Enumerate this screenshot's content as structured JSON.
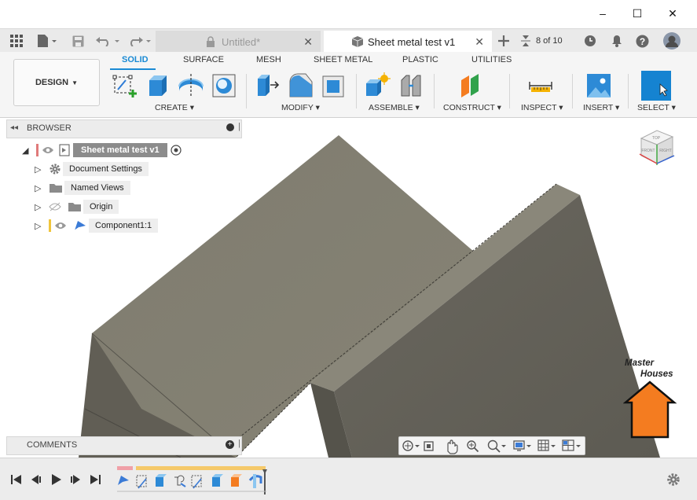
{
  "window": {
    "minimize_glyph": "–",
    "maximize_glyph": "☐",
    "close_glyph": "✕"
  },
  "tabs": [
    {
      "title": "Untitled*",
      "locked": true,
      "active": false
    },
    {
      "title": "Sheet metal test v1",
      "active": true
    }
  ],
  "tab_strip": {
    "job_status": "8 of 10"
  },
  "toolbar": {
    "workspace_button": "DESIGN",
    "workspace_tabs": [
      "SOLID",
      "SURFACE",
      "MESH",
      "SHEET METAL",
      "PLASTIC",
      "UTILITIES"
    ],
    "active_workspace_tab": "SOLID",
    "groups": [
      "CREATE",
      "MODIFY",
      "ASSEMBLE",
      "CONSTRUCT",
      "INSPECT",
      "INSERT",
      "SELECT"
    ]
  },
  "browser": {
    "title": "BROWSER",
    "root": "Sheet metal test v1",
    "items": [
      {
        "label": "Document Settings",
        "icon": "gear-icon"
      },
      {
        "label": "Named Views",
        "icon": "folder-icon"
      },
      {
        "label": "Origin",
        "icon": "folder-icon",
        "visibility": "hidden"
      },
      {
        "label": "Component1:1",
        "icon": "component-icon",
        "visibility": "visible"
      }
    ]
  },
  "comments": {
    "title": "COMMENTS"
  },
  "viewcube": {
    "faces": [
      "TOP",
      "FRONT",
      "RIGHT"
    ]
  },
  "watermark": {
    "line1": "Master",
    "line2": "Houses"
  },
  "colors": {
    "accent": "#1a8ad4",
    "part_top": "#807d70",
    "part_side": "#5b5950",
    "flange_face": "#67645b",
    "watermark_house": "#f47c20",
    "timeline_active": "#f5c96a"
  }
}
